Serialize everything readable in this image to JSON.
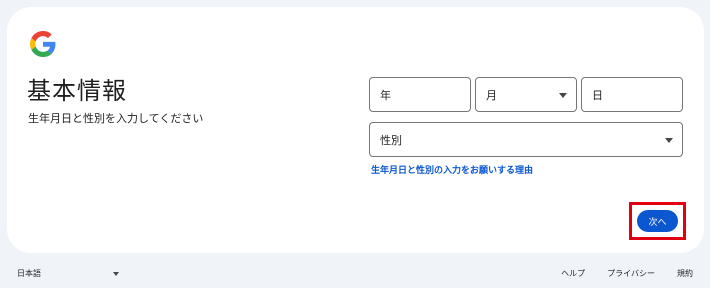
{
  "header": {
    "logo_icon": "google-g-icon",
    "title": "基本情報",
    "subtitle": "生年月日と性別を入力してください"
  },
  "form": {
    "year_label": "年",
    "month_label": "月",
    "day_label": "日",
    "gender_label": "性別",
    "reason_link": "生年月日と性別の入力をお願いする理由",
    "next_label": "次へ"
  },
  "footer": {
    "language": "日本語",
    "help": "ヘルプ",
    "privacy": "プライバシー",
    "terms": "規約"
  },
  "colors": {
    "accent": "#0b57d0",
    "highlight_border": "#e10012",
    "page_background": "#f0f4f9"
  }
}
